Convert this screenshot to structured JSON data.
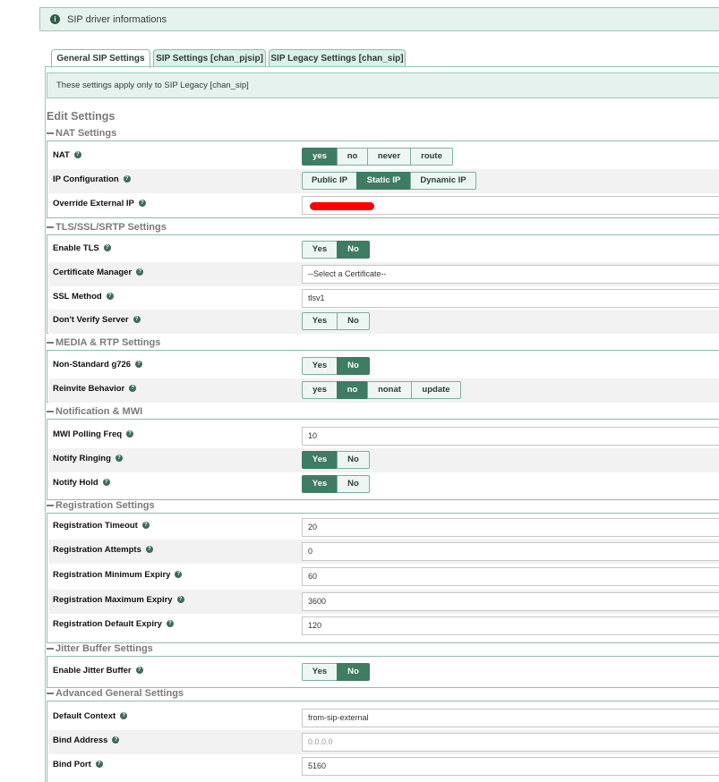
{
  "info_bar": {
    "text": "SIP driver informations",
    "icon": "info-icon"
  },
  "tabs": [
    {
      "label": "General SIP Settings",
      "active": true
    },
    {
      "label": "SIP Settings [chan_pjsip]",
      "active": false
    },
    {
      "label": "SIP Legacy Settings [chan_sip]",
      "active": false
    }
  ],
  "notice": "These settings apply only to SIP Legacy [chan_sip]",
  "edit_title": "Edit Settings",
  "sections": {
    "nat": "NAT Settings",
    "tls": "TLS/SSL/SRTP Settings",
    "media": "MEDIA & RTP Settings",
    "notif": "Notification & MWI",
    "reg": "Registration Settings",
    "jitter": "Jitter Buffer Settings",
    "adv": "Advanced General Settings"
  },
  "labels": {
    "nat": "NAT",
    "ip_config": "IP Configuration",
    "override_ip": "Override External IP",
    "enable_tls": "Enable TLS",
    "cert_manager": "Certificate Manager",
    "ssl_method": "SSL Method",
    "dont_verify": "Don't Verify Server",
    "g726": "Non-Standard g726",
    "reinvite": "Reinvite Behavior",
    "mwi_poll": "MWI Polling Freq",
    "notify_ringing": "Notify Ringing",
    "notify_hold": "Notify Hold",
    "reg_timeout": "Registration Timeout",
    "reg_attempts": "Registration Attempts",
    "reg_min": "Registration Minimum Expiry",
    "reg_max": "Registration Maximum Expiry",
    "reg_default": "Registration Default Expiry",
    "enable_jitter": "Enable Jitter Buffer",
    "default_context": "Default Context",
    "bind_address": "Bind Address",
    "bind_port": "Bind Port"
  },
  "options": {
    "nat": [
      "yes",
      "no",
      "never",
      "route"
    ],
    "ip_config": [
      "Public IP",
      "Static IP",
      "Dynamic IP"
    ],
    "yes_no": [
      "Yes",
      "No"
    ],
    "reinvite": [
      "yes",
      "no",
      "nonat",
      "update"
    ]
  },
  "values": {
    "cert_manager": "--Select a Certificate--",
    "ssl_method": "tlsv1",
    "mwi_poll": "10",
    "reg_timeout": "20",
    "reg_attempts": "0",
    "reg_min": "60",
    "reg_max": "3600",
    "reg_default": "120",
    "default_context": "from-sip-external",
    "bind_address": "0.0.0.0",
    "bind_port": "5160"
  },
  "colors": {
    "accent": "#3e7c63",
    "info_bg": "#e6f2ee",
    "redaction": "#ff0000"
  }
}
